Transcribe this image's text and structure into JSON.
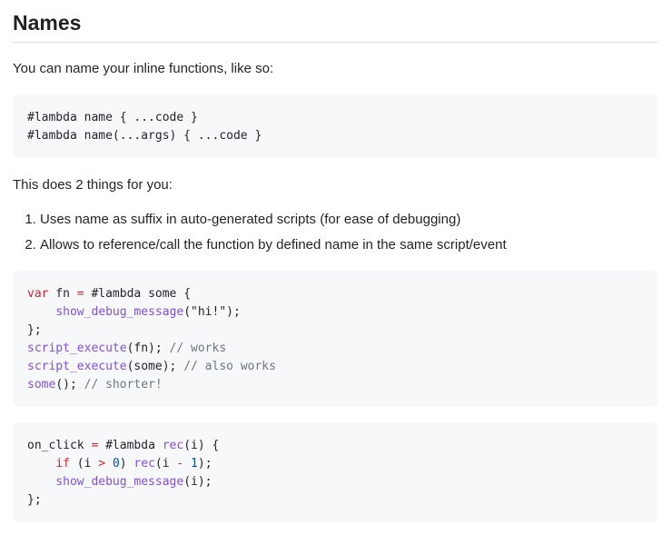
{
  "heading": "Names",
  "intro": "You can name your inline functions, like so:",
  "code1": {
    "line1": "#lambda name { ...code }",
    "line2": "#lambda name(...args) { ...code }"
  },
  "things_intro": "This does 2 things for you:",
  "list": [
    "Uses name as suffix in auto-generated scripts (for ease of debugging)",
    "Allows to reference/call the function by defined name in the same script/event"
  ],
  "code2": {
    "l1_kw": "var",
    "l1_rest": " fn ",
    "l1_eq": "=",
    "l1_tail": " #lambda some {",
    "l2_indent": "    ",
    "l2_fn": "show_debug_message",
    "l2_tail": "(\"hi!\");",
    "l3": "};",
    "l4_fn": "script_execute",
    "l4_tail": "(fn); ",
    "l4_cm": "// works",
    "l5_fn": "script_execute",
    "l5_tail": "(some); ",
    "l5_cm": "// also works",
    "l6_fn": "some",
    "l6_tail": "(); ",
    "l6_cm": "// shorter!"
  },
  "code3": {
    "l1_a": "on_click ",
    "l1_eq": "=",
    "l1_b": " #lambda ",
    "l1_fn": "rec",
    "l1_c": "(i) {",
    "l2_indent": "    ",
    "l2_kw": "if",
    "l2_a": " (i ",
    "l2_op": ">",
    "l2_sp": " ",
    "l2_num": "0",
    "l2_b": ") ",
    "l2_fn": "rec",
    "l2_c": "(i ",
    "l2_op2": "-",
    "l2_sp2": " ",
    "l2_num2": "1",
    "l2_d": ");",
    "l3_indent": "    ",
    "l3_fn": "show_debug_message",
    "l3_tail": "(i);",
    "l4": "};"
  }
}
